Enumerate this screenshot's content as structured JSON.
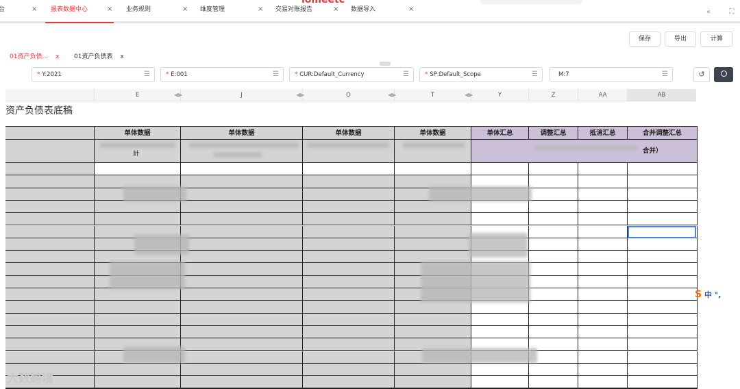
{
  "topbar": {
    "brand": "iomeetc",
    "tabs": [
      {
        "label": "台",
        "close": "×"
      },
      {
        "label": "报表数据中心",
        "close": "×"
      },
      {
        "label": "业务规则",
        "close": "×"
      },
      {
        "label": "维度管理",
        "close": "×"
      },
      {
        "label": "交易对账报告",
        "close": "×"
      },
      {
        "label": "数据导入",
        "close": "×"
      }
    ],
    "collapse_icon": "«",
    "fullscreen_icon": "⛶"
  },
  "toolbar": {
    "save": "保存",
    "export": "导出",
    "calc": "计算"
  },
  "subtabs": [
    {
      "label": "01资产负债...",
      "close": "x"
    },
    {
      "label": "01资产负债表",
      "close": "x"
    }
  ],
  "dims": [
    {
      "label": "Y:2021",
      "required": "*"
    },
    {
      "label": "E:001",
      "required": "*"
    },
    {
      "label": "CUR:Default_Currency",
      "required": "*"
    },
    {
      "label": "SP:Default_Scope",
      "required": "*"
    },
    {
      "label": "M:7",
      "required": ""
    }
  ],
  "list_icon": "☰",
  "reset_icon": "↺",
  "search_icon": "🔍",
  "columns": [
    "E",
    "J",
    "O",
    "T",
    "Y",
    "Z",
    "AA",
    "AB"
  ],
  "sheet_title": "资产负债表底稿",
  "header_row": [
    "单体数据",
    "单体数据",
    "单体数据",
    "单体数据",
    "单体汇总",
    "调整汇总",
    "抵消汇总",
    "合并调整汇总"
  ],
  "header_row2_partial": {
    "e": "計",
    "merged": "合并）"
  },
  "watermark": "大数跨境",
  "ime": {
    "logo": "S",
    "text": "中 °,"
  },
  "colors": {
    "accent": "#e03c3c",
    "grey_cells": "#d4d4d4",
    "purple_cells": "#ccc0d9",
    "selection": "#4a86e8"
  }
}
